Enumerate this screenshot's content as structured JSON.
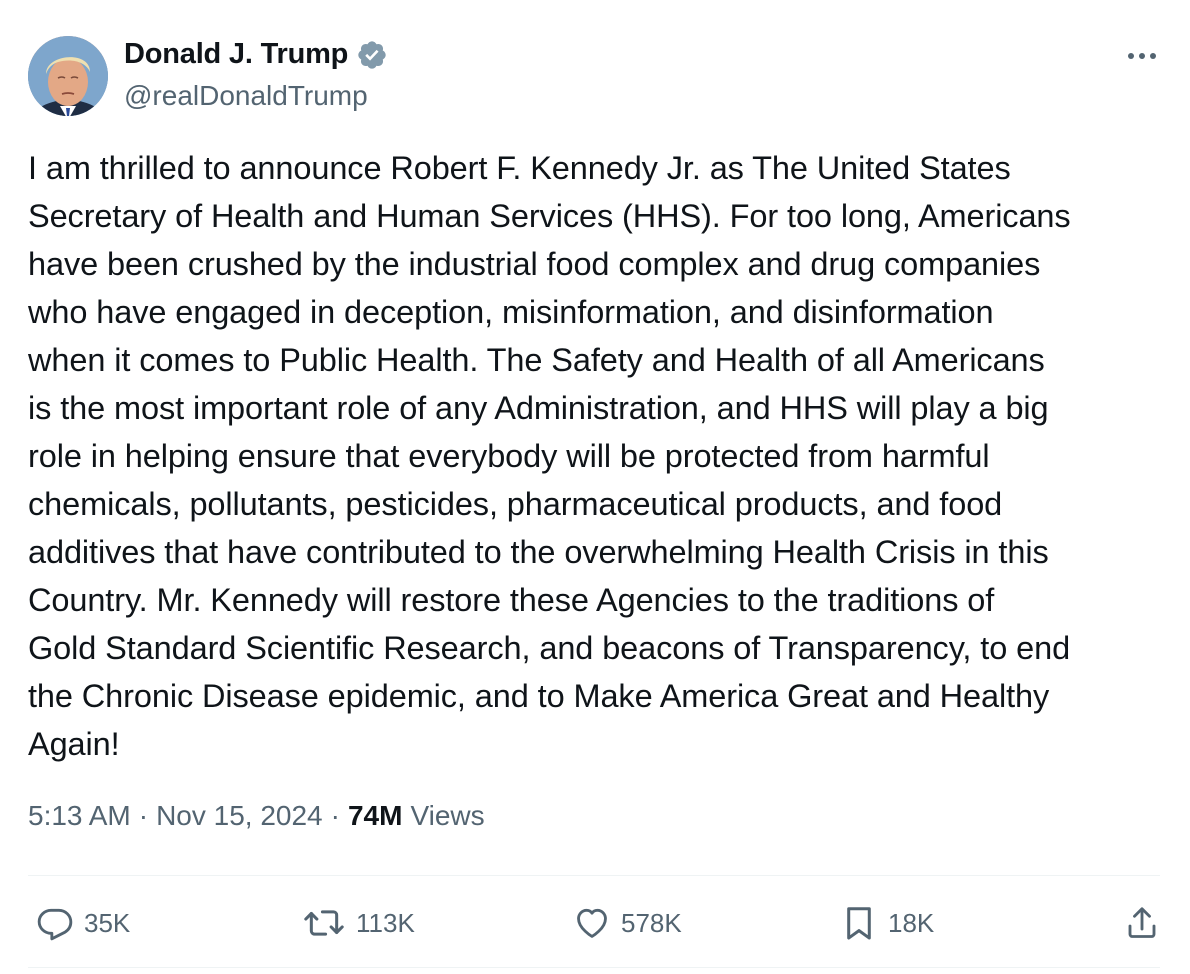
{
  "author": {
    "display_name": "Donald J. Trump",
    "handle": "@realDonaldTrump",
    "verified": true,
    "verified_color": "#829aab"
  },
  "tweet": {
    "text": "I am thrilled to announce Robert F. Kennedy Jr. as The United States\nSecretary of Health and Human Services (HHS). For too long, Americans\nhave been crushed by the industrial food complex and drug companies\nwho have engaged in deception, misinformation, and disinformation\nwhen it comes to Public Health. The Safety and Health of all Americans\nis the most important role of any Administration, and HHS will play a big\nrole in helping ensure that everybody will be protected from harmful\nchemicals, pollutants, pesticides, pharmaceutical products, and food\nadditives that have contributed to the overwhelming Health Crisis in this\nCountry. Mr. Kennedy will restore these Agencies to the traditions of\nGold Standard Scientific Research, and beacons of Transparency, to end\nthe Chronic Disease epidemic, and to Make America Great and Healthy\nAgain!",
    "time": "5:13 AM",
    "date": "Nov 15, 2024",
    "separator": "·",
    "views_count": "74M",
    "views_label": "Views"
  },
  "actions": {
    "replies": "35K",
    "reposts": "113K",
    "likes": "578K",
    "bookmarks": "18K"
  },
  "icons": {
    "more": "more-horizontal-icon",
    "reply": "reply-bubble-icon",
    "repost": "repost-arrows-icon",
    "like": "heart-icon",
    "bookmark": "bookmark-icon",
    "share": "share-upload-icon"
  },
  "colors": {
    "text_primary": "#0f1419",
    "text_secondary": "#536471",
    "divider": "#eff3f4"
  }
}
